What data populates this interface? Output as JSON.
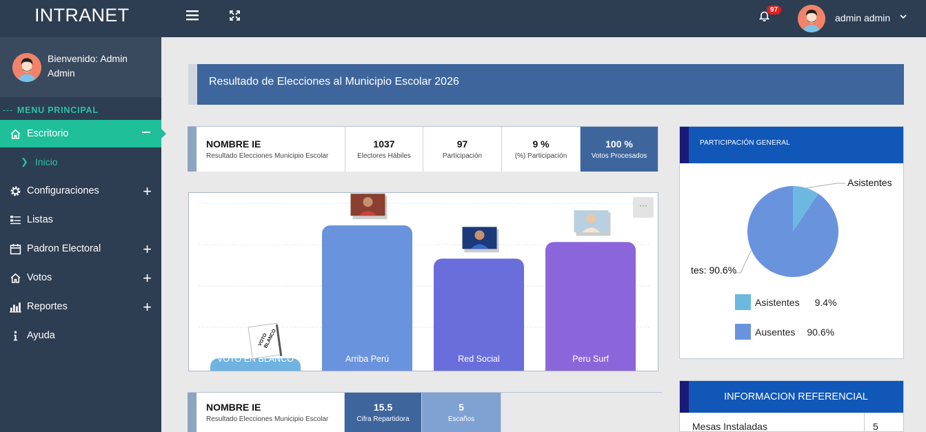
{
  "brand": "INTRANET",
  "topbar": {
    "notification_count": "97",
    "user_name": "admin admin"
  },
  "sidebar": {
    "welcome": "Bienvenido: Admin Admin",
    "menu_title": "MENU PRINCIPAL",
    "items": [
      {
        "label": "Escritorio"
      },
      {
        "label": "Inicio"
      },
      {
        "label": "Configuraciones"
      },
      {
        "label": "Listas"
      },
      {
        "label": "Padron Electoral"
      },
      {
        "label": "Votos"
      },
      {
        "label": "Reportes"
      },
      {
        "label": "Ayuda"
      }
    ]
  },
  "banner": {
    "title": "Resultado de Elecciones al Municipio Escolar 2026"
  },
  "stats": {
    "ie_name": "NOMBRE IE",
    "ie_sub": "Resultado Elecciones Municipio Escolar",
    "electores_value": "1037",
    "electores_label": "Electores Hábiles",
    "participacion_value": "97",
    "participacion_label": "Participación",
    "pct_value": "9 %",
    "pct_label": "(%) Participación",
    "procesados_value": "100 %",
    "procesados_label": "Votos Procesados"
  },
  "chart_data": [
    {
      "type": "bar",
      "categories": [
        "VOTO EN BLANCO",
        "Arriba Perú",
        "Red Social",
        "Peru Surf"
      ],
      "values": [
        2,
        35,
        27,
        31
      ],
      "ylim": [
        0,
        40
      ],
      "grid": true,
      "colors": [
        "#6fb3e0",
        "#6a93dd",
        "#6a6edb",
        "#8b66db"
      ]
    },
    {
      "type": "pie",
      "title": "PARTICIPACIÓN GENERAL",
      "categories": [
        "Asistentes",
        "Ausentes"
      ],
      "values": [
        9.4,
        90.6
      ],
      "colors": [
        "#6cb8e0",
        "#6a93dd"
      ],
      "labels": [
        "Asistentes",
        "tes: 90.6%"
      ],
      "legend": [
        {
          "name": "Asistentes",
          "pct": "9.4%"
        },
        {
          "name": "Ausentes",
          "pct": "90.6%"
        }
      ]
    }
  ],
  "blank_vote_tag": "VOTO BLANCO",
  "chart_menu": "···",
  "stats2": {
    "ie_name": "NOMBRE IE",
    "ie_sub": "Resultado Elecciones Municipio Escolar",
    "cifra_value": "15.5",
    "cifra_label": "Cifra Repartidora",
    "escanos_value": "5",
    "escanos_label": "Escaños"
  },
  "info": {
    "title": "INFORMACION REFERENCIAL",
    "rows": [
      {
        "key": "Mesas Instaladas",
        "value": "5"
      }
    ]
  }
}
